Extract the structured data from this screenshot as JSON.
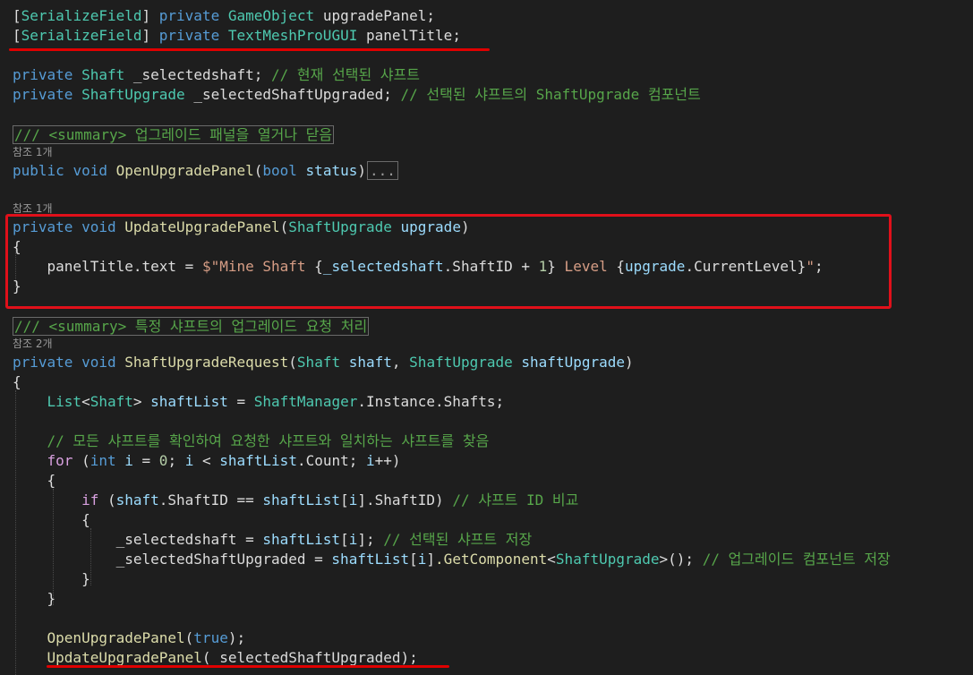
{
  "code": {
    "l1": {
      "attr": "SerializeField",
      "mod": "private",
      "type": "GameObject",
      "name": "upgradePanel;"
    },
    "l2": {
      "attr": "SerializeField",
      "mod": "private",
      "type": "TextMeshProUGUI",
      "name": "panelTitle;"
    },
    "l3": {
      "mod": "private",
      "type": "Shaft",
      "name": "_selectedshaft;",
      "comment": "// 현재 선택된 샤프트"
    },
    "l4": {
      "mod": "private",
      "type": "ShaftUpgrade",
      "name": "_selectedShaftUpgraded;",
      "comment": "// 선택된 샤프트의 ShaftUpgrade 컴포넌트"
    },
    "summary1": "/// <summary> 업그레이드 패널을 열거나 닫음",
    "ref1": "참조 1개",
    "open_decl": {
      "mod": "public",
      "ret": "void",
      "fn": "OpenUpgradePanel",
      "ptype": "bool",
      "pname": "status",
      "collapsed": "..."
    },
    "ref2": "참조 1개",
    "update_decl": {
      "mod": "private",
      "ret": "void",
      "fn": "UpdateUpgradePanel",
      "ptype": "ShaftUpgrade",
      "pname": "upgrade"
    },
    "update_body": {
      "lhs": "panelTitle.text",
      "str_start": "$\"Mine Shaft ",
      "i1_var": "_selectedshaft",
      "i1_prop": ".ShaftID",
      "i1_num": "1",
      "str_mid": " Level ",
      "i2_var": "upgrade",
      "i2_prop": ".CurrentLevel",
      "str_end": "\""
    },
    "summary2": "/// <summary> 특정 샤프트의 업그레이드 요청 처리",
    "ref3": "참조 2개",
    "req_decl": {
      "mod": "private",
      "ret": "void",
      "fn": "ShaftUpgradeRequest",
      "p1type": "Shaft",
      "p1name": "shaft",
      "p2type": "ShaftUpgrade",
      "p2name": "shaftUpgrade"
    },
    "list_line": {
      "gtype": "List",
      "targ": "Shaft",
      "var": "shaftList",
      "cls": "ShaftManager",
      "rest": ".Instance.Shafts;"
    },
    "comment_find": "// 모든 샤프트를 확인하여 요청한 샤프트와 일치하는 샤프트를 찾음",
    "for_line": {
      "kw": "for",
      "itype": "int",
      "ivar": "i",
      "zero": "0",
      "list": "shaftList",
      "prop": ".Count"
    },
    "if_line": {
      "kw": "if",
      "v1": "shaft",
      "p1": ".ShaftID",
      "v2": "shaftList",
      "p2": ".ShaftID",
      "comment": "// 샤프트 ID 비교"
    },
    "sel_line": {
      "lhs": "_selectedshaft",
      "rhs": "shaftList",
      "comment": "// 선택된 샤프트 저장"
    },
    "sel_up_line": {
      "lhs": "_selectedShaftUpgraded",
      "rhs": "shaftList",
      "fn": ".GetComponent",
      "targ": "ShaftUpgrade",
      "comment": "// 업그레이드 컴포넌트 저장"
    },
    "call1": {
      "fn": "OpenUpgradePanel",
      "arg": "true"
    },
    "call2": {
      "fn": "UpdateUpgradePanel",
      "arg": "_selectedShaftUpgraded"
    }
  }
}
